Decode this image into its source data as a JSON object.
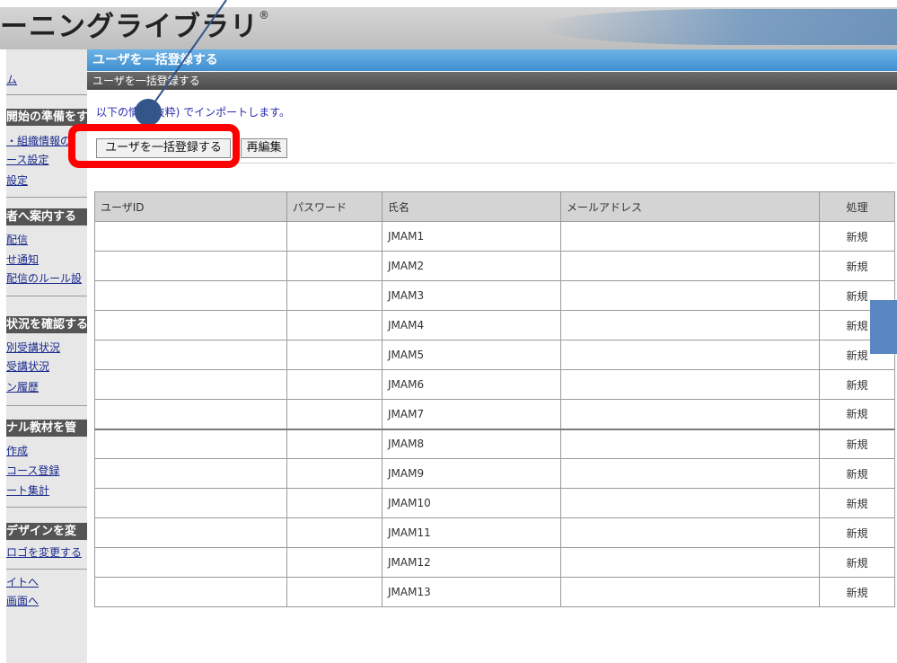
{
  "header": {
    "brand_title": "ーニングライブラリ",
    "registered_mark": "®"
  },
  "sidebar": {
    "top_link": "ム",
    "sections": [
      {
        "heading": "開始の準備をす",
        "links": [
          "・組織情報の",
          "ース設定",
          "設定"
        ]
      },
      {
        "heading": "者へ案内する",
        "links": [
          "配信",
          "せ通知",
          "配信のルール設"
        ]
      },
      {
        "heading": "状況を確認する",
        "links": [
          "別受講状況",
          "受講状況",
          "ン履歴"
        ]
      },
      {
        "heading": "ナル教材を管",
        "links": [
          "作成",
          "コース登録",
          "ート集計"
        ]
      },
      {
        "heading": "デザインを変",
        "links": [
          "ロゴを変更する"
        ]
      }
    ],
    "bottom_links": [
      "イトへ",
      "画面へ"
    ]
  },
  "main": {
    "title": "ユーザを一括登録する",
    "subtitle": "ユーザを一括登録する",
    "import_message": "以下の情報(抜粋) でインポートします。",
    "buttons": {
      "bulk_register": "ユーザを一括登録する",
      "re_edit": "再編集"
    }
  },
  "table": {
    "headers": {
      "user_id": "ユーザID",
      "password": "パスワード",
      "name": "氏名",
      "email": "メールアドレス",
      "action": "処理"
    },
    "rows": [
      {
        "user_id": "",
        "password": "",
        "name": "JMAM1",
        "email": "",
        "action": "新規"
      },
      {
        "user_id": "",
        "password": "",
        "name": "JMAM2",
        "email": "",
        "action": "新規"
      },
      {
        "user_id": "",
        "password": "",
        "name": "JMAM3",
        "email": "",
        "action": "新規"
      },
      {
        "user_id": "",
        "password": "",
        "name": "JMAM4",
        "email": "",
        "action": "新規"
      },
      {
        "user_id": "",
        "password": "",
        "name": "JMAM5",
        "email": "",
        "action": "新規"
      },
      {
        "user_id": "",
        "password": "",
        "name": "JMAM6",
        "email": "",
        "action": "新規"
      },
      {
        "user_id": "",
        "password": "",
        "name": "JMAM7",
        "email": "",
        "action": "新規"
      },
      {
        "user_id": "",
        "password": "",
        "name": "JMAM8",
        "email": "",
        "action": "新規"
      },
      {
        "user_id": "",
        "password": "",
        "name": "JMAM9",
        "email": "",
        "action": "新規"
      },
      {
        "user_id": "",
        "password": "",
        "name": "JMAM10",
        "email": "",
        "action": "新規"
      },
      {
        "user_id": "",
        "password": "",
        "name": "JMAM11",
        "email": "",
        "action": "新規"
      },
      {
        "user_id": "",
        "password": "",
        "name": "JMAM12",
        "email": "",
        "action": "新規"
      },
      {
        "user_id": "",
        "password": "",
        "name": "JMAM13",
        "email": "",
        "action": "新規"
      }
    ]
  },
  "colors": {
    "title_bar": "#3f8fd0",
    "sub_bar": "#4c4c4c",
    "highlight": "#ff0000",
    "pointer": "#34558a",
    "link": "#1a2a8c"
  },
  "icons": {
    "pointer": "pointer-arrow-icon"
  }
}
